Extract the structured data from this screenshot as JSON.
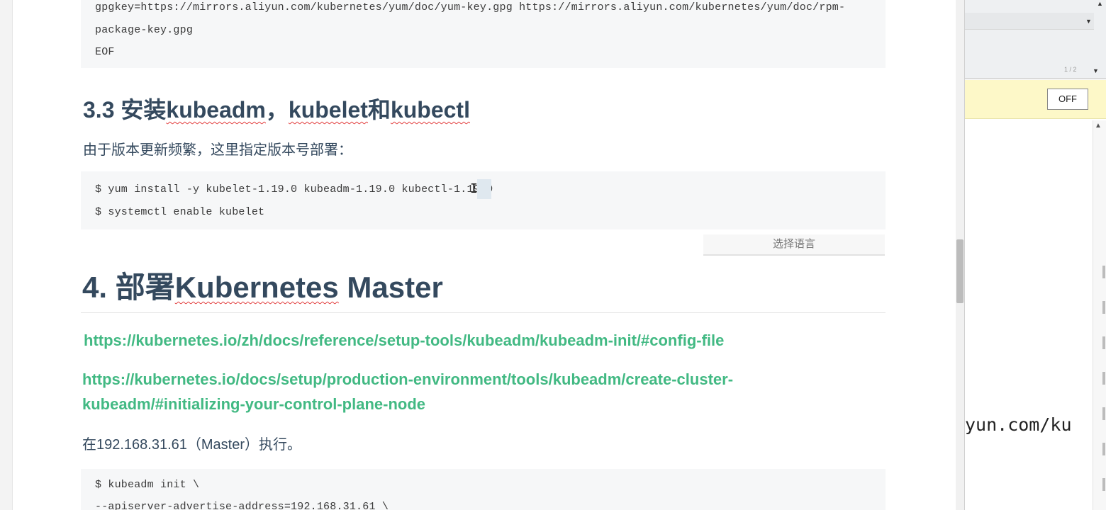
{
  "document": {
    "gpg_code": {
      "line1": "gpgkey=https://mirrors.aliyun.com/kubernetes/yum/doc/yum-key.gpg https://mirrors.aliyun.com/kubernetes/yum/doc/rpm-",
      "line2": "package-key.gpg",
      "line3": "EOF"
    },
    "section_3_3": {
      "title_prefix": "3.3 安装",
      "title_w1": "kubeadm",
      "title_sep": "，",
      "title_w2": "kubelet",
      "title_and": "和",
      "title_w3": "kubectl",
      "intro": "由于版本更新频繁，这里指定版本号部署："
    },
    "install_code": {
      "line1_a": "$ yum install -y kubelet-1.19.0 kubeadm-1.19.0 kubectl-1.",
      "line1_b": "19.0",
      "line2": "$ systemctl enable kubelet"
    },
    "language_selector": "选择语言",
    "section_4": {
      "title_prefix": "4. 部署",
      "title_word": "Kubernetes",
      "title_suffix": " Master",
      "link1": "https://kubernetes.io/zh/docs/reference/setup-tools/kubeadm/kubeadm-init/#config-file",
      "link2": "https://kubernetes.io/docs/setup/production-environment/tools/kubeadm/create-cluster-kubeadm/#initializing-your-control-plane-node",
      "exec_note": "在192.168.31.61（Master）执行。"
    },
    "init_code": {
      "line1": "$ kubeadm init \\",
      "line2": "  --apiserver-advertise-address=192.168.31.61 \\"
    }
  },
  "right_panel": {
    "off_button": "OFF",
    "ruler_label": "1 / 2",
    "terminal_fragment": "yun.com/ku"
  },
  "colors": {
    "link": "#42b983",
    "heading": "#34495e",
    "banner": "#fdf8c8"
  }
}
